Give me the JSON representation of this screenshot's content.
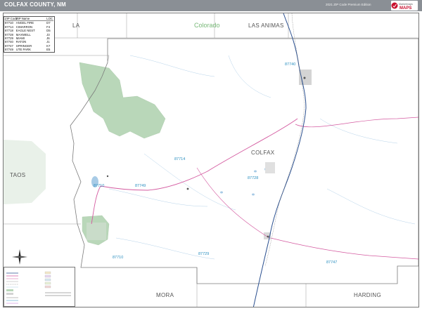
{
  "header": {
    "title": "COLFAX COUNTY, NM",
    "edition": "2021 ZIP Code Premium Edition",
    "brand_top": "Marketmaps",
    "brand_main": "MAPS"
  },
  "zip_table": {
    "columns": [
      "ZIP Code",
      "ZIP Name",
      "LOC"
    ],
    "rows": [
      [
        "87710",
        "ANGEL FIRE",
        "D7"
      ],
      [
        "87714",
        "CIMARRON",
        "F4"
      ],
      [
        "87718",
        "EAGLE NEST",
        "D5"
      ],
      [
        "87728",
        "MAXWELL",
        "J3"
      ],
      [
        "87729",
        "MIAMI",
        "J6"
      ],
      [
        "87740",
        "RATON",
        "J1"
      ],
      [
        "87747",
        "SPRINGER",
        "K7"
      ],
      [
        "87749",
        "UTE PARK",
        "E5"
      ]
    ]
  },
  "map": {
    "state_label": "Colorado",
    "county_labels": {
      "main": "COLFAX",
      "north_left": "LA",
      "north": "LAS ANIMAS",
      "west": "TAOS",
      "south": "MORA",
      "southeast": "HARDING"
    },
    "zip_labels": [
      "87740",
      "87714",
      "87728",
      "87710",
      "87749",
      "87729",
      "87747",
      "87710"
    ],
    "colors": {
      "county_fill": "#ffffff",
      "outside_fill": "#ffffff",
      "boundary": "#888888",
      "forest": "#b9d7b9",
      "highway": "#d45aa0",
      "interstate": "#2a4f8f",
      "water": "#a8cbe6",
      "zip_label": "#2a8fc0"
    }
  }
}
